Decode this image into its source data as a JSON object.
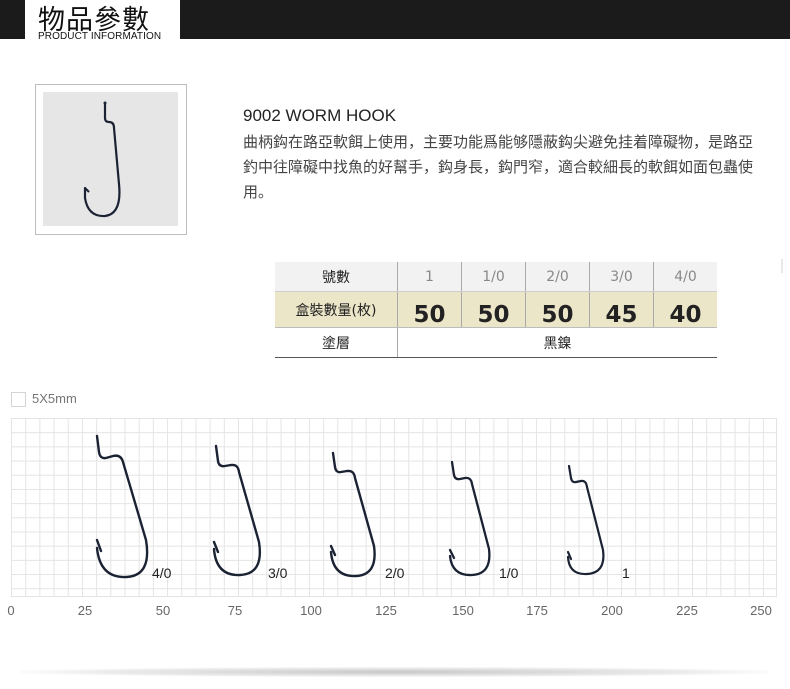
{
  "header": {
    "title": "物品參數",
    "subtitle": "PRODUCT INFORMATION"
  },
  "product": {
    "name": "9002 WORM HOOK",
    "description": "曲柄鈎在路亞軟餌上使用，主要功能爲能够隱蔽鈎尖避免挂着障礙物，是路亞釣中往障礙中找魚的好幫手，鈎身長，鈎門窄，適合較細長的軟餌如面包蟲使用。"
  },
  "spec_table": {
    "size_label": "號數",
    "sizes": [
      "1",
      "1/0",
      "2/0",
      "3/0",
      "4/0"
    ],
    "qty_label": "盒裝數量(枚)",
    "quantities": [
      "50",
      "50",
      "50",
      "45",
      "40"
    ],
    "coating_label": "塗層",
    "coating_value": "黑鎳"
  },
  "grid": {
    "legend": "5X5mm",
    "ruler": [
      "0",
      "25",
      "50",
      "75",
      "100",
      "125",
      "150",
      "175",
      "200",
      "225",
      "250"
    ]
  },
  "hooks": [
    {
      "size": "4/0"
    },
    {
      "size": "3/0"
    },
    {
      "size": "2/0"
    },
    {
      "size": "1/0"
    },
    {
      "size": "1"
    }
  ],
  "colors": {
    "header_band": "#1b1b1b",
    "qty_row": "#ece6c8",
    "hook": "#1a2233"
  }
}
